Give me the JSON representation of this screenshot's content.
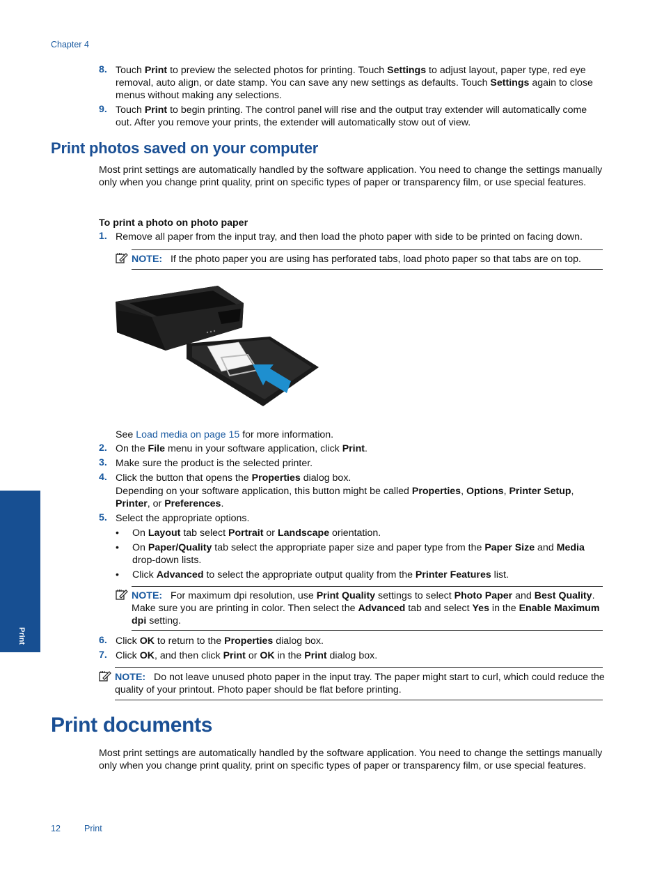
{
  "header": {
    "chapter": "Chapter 4"
  },
  "intro_steps": [
    {
      "num": "8.",
      "parts": [
        "Touch ",
        {
          "b": "Print"
        },
        " to preview the selected photos for printing. Touch ",
        {
          "b": "Settings"
        },
        " to adjust layout, paper type, red eye removal, auto align, or date stamp. You can save any new settings as defaults. Touch ",
        {
          "b": "Settings"
        },
        " again to close menus without making any selections."
      ]
    },
    {
      "num": "9.",
      "parts": [
        "Touch ",
        {
          "b": "Print"
        },
        " to begin printing. The control panel will rise and the output tray extender will automatically come out. After you remove your prints, the extender will automatically stow out of view."
      ]
    }
  ],
  "section1": {
    "title": "Print photos saved on your computer",
    "intro": "Most print settings are automatically handled by the software application. You need to change the settings manually only when you change print quality, print on specific types of paper or transparency film, or use special features.",
    "procedure_title": "To print a photo on photo paper",
    "step1": {
      "num": "1.",
      "text": "Remove all paper from the input tray, and then load the photo paper with side to be printed on facing down."
    },
    "note1": {
      "label": "NOTE:",
      "text": "If the photo paper you are using has perforated tabs, load photo paper so that tabs are on top."
    },
    "figure": {
      "alt": "printer-loading-photo-paper-illustration",
      "arrow_color": "#1e8fcf"
    },
    "see_also": {
      "prefix": "See ",
      "link": "Load media on page 15",
      "suffix": " for more information."
    },
    "step2": {
      "num": "2.",
      "parts": [
        "On the ",
        {
          "b": "File"
        },
        " menu in your software application, click ",
        {
          "b": "Print"
        },
        "."
      ]
    },
    "step3": {
      "num": "3.",
      "parts": [
        "Make sure the product is the selected printer."
      ]
    },
    "step4": {
      "num": "4.",
      "parts": [
        "Click the button that opens the ",
        {
          "b": "Properties"
        },
        " dialog box."
      ]
    },
    "step4_detail": {
      "parts": [
        "Depending on your software application, this button might be called ",
        {
          "b": "Properties"
        },
        ", ",
        {
          "b": "Options"
        },
        ", ",
        {
          "b": "Printer Setup"
        },
        ", ",
        {
          "b": "Printer"
        },
        ", or ",
        {
          "b": "Preferences"
        },
        "."
      ]
    },
    "step5": {
      "num": "5.",
      "parts": [
        "Select the appropriate options."
      ]
    },
    "bullets": [
      {
        "parts": [
          "On ",
          {
            "b": "Layout"
          },
          " tab select ",
          {
            "b": "Portrait"
          },
          " or ",
          {
            "b": "Landscape"
          },
          " orientation."
        ]
      },
      {
        "parts": [
          "On ",
          {
            "b": "Paper/Quality"
          },
          " tab select the appropriate paper size and paper type from the ",
          {
            "b": "Paper Size"
          },
          " and ",
          {
            "b": "Media"
          },
          " drop-down lists."
        ]
      },
      {
        "parts": [
          "Click ",
          {
            "b": "Advanced"
          },
          " to select the appropriate output quality from the ",
          {
            "b": "Printer Features"
          },
          " list."
        ]
      }
    ],
    "note2": {
      "label": "NOTE:",
      "parts": [
        "For maximum dpi resolution, use ",
        {
          "b": "Print Quality"
        },
        " settings to select ",
        {
          "b": "Photo Paper"
        },
        " and ",
        {
          "b": "Best Quality"
        },
        ". Make sure you are printing in color. Then select the ",
        {
          "b": "Advanced"
        },
        " tab and select ",
        {
          "b": "Yes"
        },
        " in the ",
        {
          "b": "Enable Maximum dpi"
        },
        " setting."
      ]
    },
    "step6": {
      "num": "6.",
      "parts": [
        "Click ",
        {
          "b": "OK"
        },
        " to return to the ",
        {
          "b": "Properties"
        },
        " dialog box."
      ]
    },
    "step7": {
      "num": "7.",
      "parts": [
        "Click ",
        {
          "b": "OK"
        },
        ", and then click ",
        {
          "b": "Print"
        },
        " or ",
        {
          "b": "OK"
        },
        " in the ",
        {
          "b": "Print"
        },
        " dialog box."
      ]
    },
    "note3": {
      "label": "NOTE:",
      "text": "Do not leave unused photo paper in the input tray. The paper might start to curl, which could reduce the quality of your printout. Photo paper should be flat before printing."
    }
  },
  "section2": {
    "title": "Print documents",
    "intro": "Most print settings are automatically handled by the software application. You need to change the settings manually only when you change print quality, print on specific types of paper or transparency film, or use special features."
  },
  "side_tab": {
    "label": "Print",
    "color": "#174f92"
  },
  "footer": {
    "page_number": "12",
    "section": "Print"
  }
}
